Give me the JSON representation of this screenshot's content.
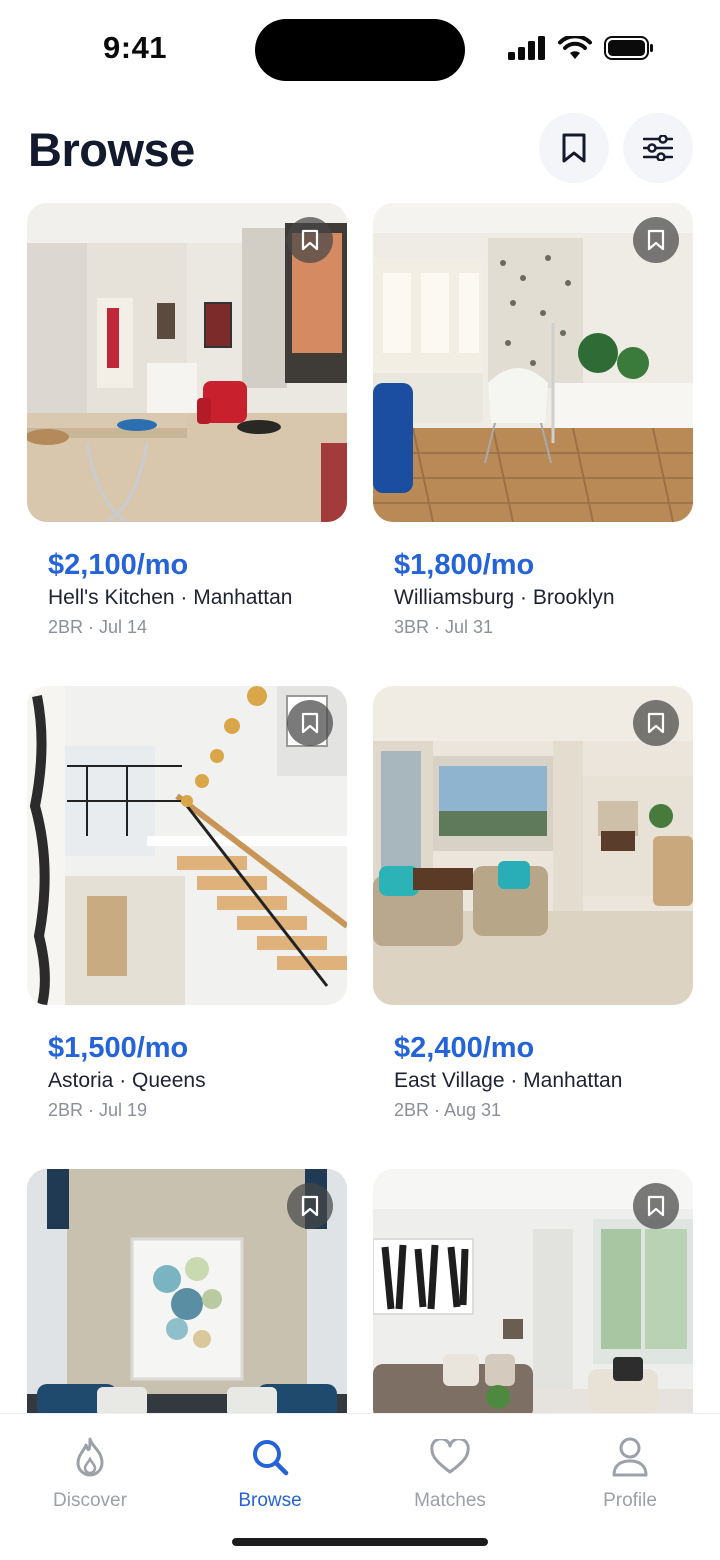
{
  "status_bar": {
    "time": "9:41"
  },
  "header": {
    "title": "Browse"
  },
  "listings": [
    {
      "price": "$2,100/mo",
      "location": "Hell's Kitchen · Manhattan",
      "details": "2BR · Jul 14",
      "photo": "living-room-red-armchair"
    },
    {
      "price": "$1,800/mo",
      "location": "Williamsburg · Brooklyn",
      "details": "3BR · Jul 31",
      "photo": "bright-room-herringbone-floor"
    },
    {
      "price": "$1,500/mo",
      "location": "Astoria · Queens",
      "details": "2BR · Jul 19",
      "photo": "staircase-pendant-lights"
    },
    {
      "price": "$2,400/mo",
      "location": "East Village · Manhattan",
      "details": "2BR · Aug 31",
      "photo": "living-room-beige-sofas"
    },
    {
      "price": "",
      "location": "",
      "details": "",
      "photo": "sofa-abstract-painting"
    },
    {
      "price": "",
      "location": "",
      "details": "",
      "photo": "living-room-black-white-art"
    }
  ],
  "tabs": [
    {
      "label": "Discover",
      "icon": "flame-icon",
      "active": false
    },
    {
      "label": "Browse",
      "icon": "search-icon",
      "active": true
    },
    {
      "label": "Matches",
      "icon": "heart-icon",
      "active": false
    },
    {
      "label": "Profile",
      "icon": "person-icon",
      "active": false
    }
  ],
  "colors": {
    "accent": "#2563d9",
    "inactive_tab": "#9ca0a9",
    "title": "#141a2e",
    "meta": "#8b8f99"
  }
}
